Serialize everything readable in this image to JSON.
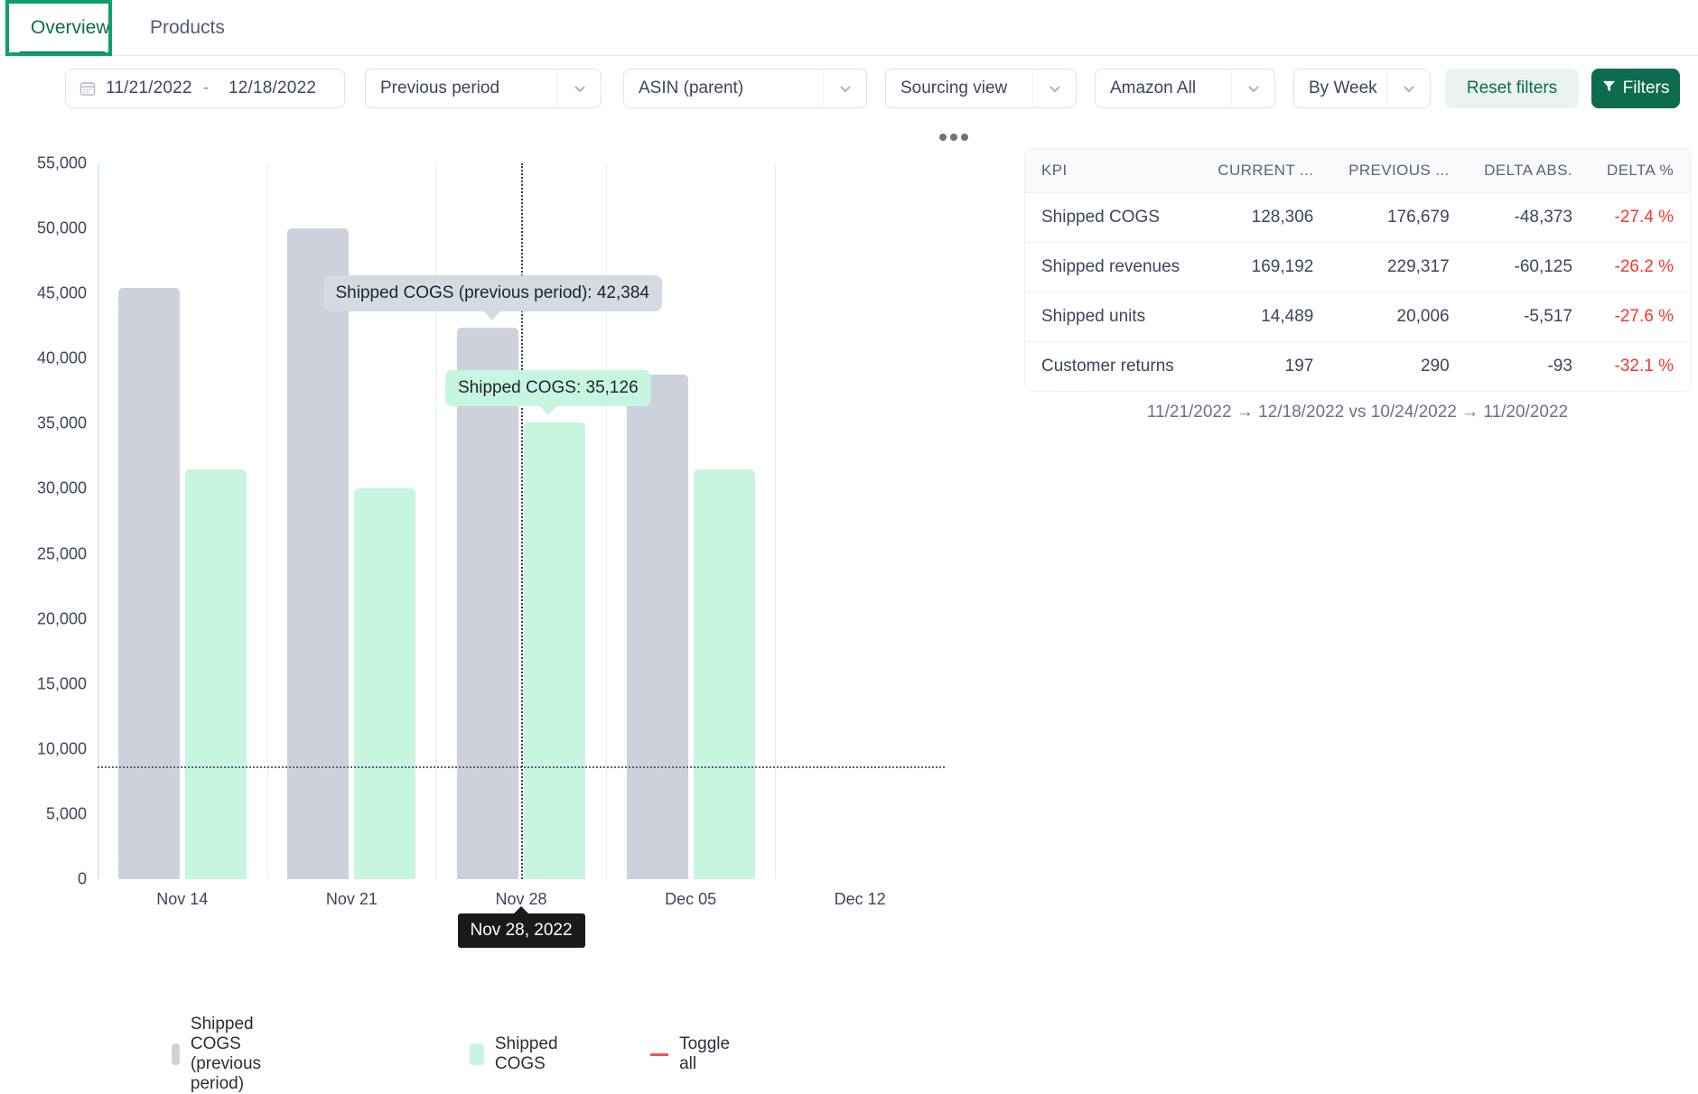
{
  "tabs": [
    {
      "label": "Overview",
      "active": true
    },
    {
      "label": "Products",
      "active": false
    }
  ],
  "filters": {
    "date_range": {
      "start": "11/21/2022",
      "separator": "-",
      "end": "12/18/2022",
      "icon": "calendar-icon"
    },
    "comparison": "Previous period",
    "grouping": "ASIN (parent)",
    "view": "Sourcing view",
    "marketplace": "Amazon All",
    "granularity": "By Week",
    "reset_label": "Reset filters",
    "filters_label": "Filters"
  },
  "chart_data": {
    "type": "bar",
    "title": "",
    "xlabel": "",
    "ylabel": "",
    "ylim": [
      0,
      55000
    ],
    "grid": true,
    "legend_position": "bottom",
    "categories": [
      "Nov 14",
      "Nov 21",
      "Nov 28",
      "Dec 05",
      "Dec 12"
    ],
    "ytick_labels": [
      "0",
      "5,000",
      "10,000",
      "15,000",
      "20,000",
      "25,000",
      "30,000",
      "35,000",
      "40,000",
      "45,000",
      "50,000",
      "55,000"
    ],
    "ytick_values": [
      0,
      5000,
      10000,
      15000,
      20000,
      25000,
      30000,
      35000,
      40000,
      45000,
      50000,
      55000
    ],
    "series": [
      {
        "name": "Shipped COGS (previous period)",
        "color": "#ccd1dc",
        "values": [
          45400,
          50000,
          42384,
          38800,
          0
        ]
      },
      {
        "name": "Shipped COGS",
        "color": "#c8f5df",
        "values": [
          31500,
          30000,
          35126,
          31500,
          0
        ]
      }
    ],
    "threshold_line": {
      "value": 8700,
      "style": "dotted"
    },
    "cursor_line": {
      "category": "Nov 28",
      "style": "dotted"
    },
    "legend": [
      {
        "label": "Shipped COGS (previous period)",
        "swatch": "#ccd1dc",
        "type": "swatch"
      },
      {
        "label": "Shipped COGS",
        "swatch": "#c8f5df",
        "type": "swatch"
      },
      {
        "label": "Toggle all",
        "swatch": "#f4514f",
        "type": "line"
      }
    ],
    "tooltips": {
      "previous": "Shipped COGS (previous period): 42,384",
      "current": "Shipped COGS: 35,126",
      "axis": "Nov 28, 2022"
    },
    "more_options_icon": "more-horizontal-icon"
  },
  "kpi_table": {
    "columns": [
      "KPI",
      "CURRENT ...",
      "PREVIOUS ...",
      "DELTA ABS.",
      "DELTA %"
    ],
    "rows": [
      {
        "kpi": "Shipped COGS",
        "current": "128,306",
        "previous": "176,679",
        "delta_abs": "-48,373",
        "delta_pct": "-27.4 %"
      },
      {
        "kpi": "Shipped revenues",
        "current": "169,192",
        "previous": "229,317",
        "delta_abs": "-60,125",
        "delta_pct": "-26.2 %"
      },
      {
        "kpi": "Shipped units",
        "current": "14,489",
        "previous": "20,006",
        "delta_abs": "-5,517",
        "delta_pct": "-27.6 %"
      },
      {
        "kpi": "Customer returns",
        "current": "197",
        "previous": "290",
        "delta_abs": "-93",
        "delta_pct": "-32.1 %"
      }
    ]
  },
  "comparison_note": "11/21/2022 → 12/18/2022 vs 10/24/2022 → 11/20/2022",
  "colors": {
    "brand_green": "#0d6b4f",
    "accent_green": "#0e9f6e",
    "negative_red": "#f5362e",
    "previous_bar": "#ccd1dc",
    "current_bar": "#c8f5df"
  }
}
